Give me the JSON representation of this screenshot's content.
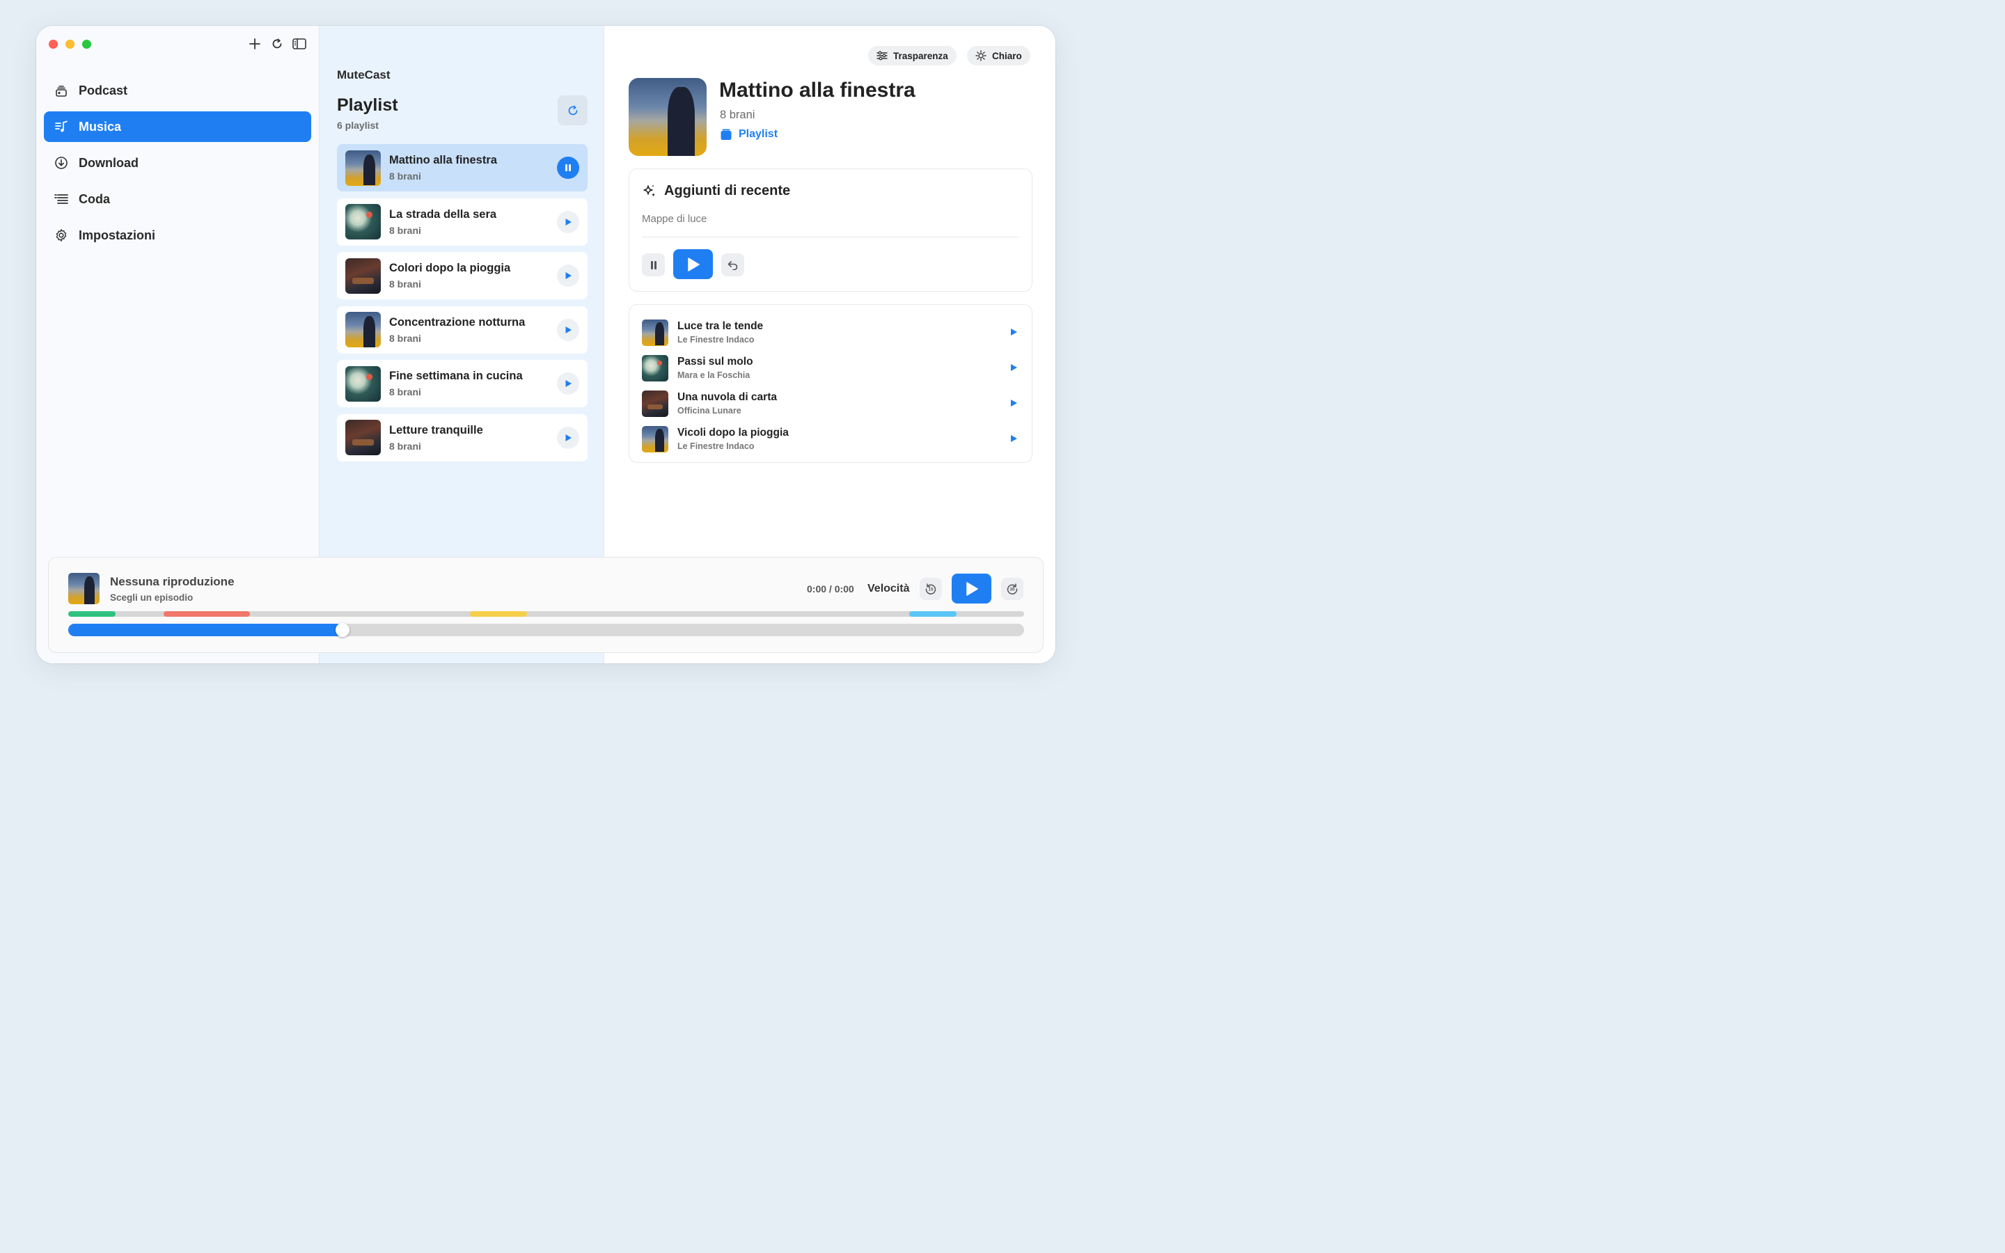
{
  "sidebar": {
    "tools": {
      "add": "plus-icon",
      "reload": "refresh-icon",
      "toggle": "sidebar-icon"
    },
    "items": [
      {
        "label": "Podcast",
        "icon": "podcast-stack-icon",
        "active": false
      },
      {
        "label": "Musica",
        "icon": "music-list-icon",
        "active": true
      },
      {
        "label": "Download",
        "icon": "download-circle-icon",
        "active": false
      },
      {
        "label": "Coda",
        "icon": "queue-list-icon",
        "active": false
      },
      {
        "label": "Impostazioni",
        "icon": "gear-icon",
        "active": false
      }
    ]
  },
  "middle": {
    "app_name": "MuteCast",
    "title": "Playlist",
    "count": "6 playlist",
    "playlists": [
      {
        "name": "Mattino alla finestra",
        "sub": "8 brani",
        "art": "a",
        "playing": true
      },
      {
        "name": "La strada della sera",
        "sub": "8 brani",
        "art": "b",
        "playing": false
      },
      {
        "name": "Colori dopo la pioggia",
        "sub": "8 brani",
        "art": "c",
        "playing": false
      },
      {
        "name": "Concentrazione notturna",
        "sub": "8 brani",
        "art": "a",
        "playing": false
      },
      {
        "name": "Fine settimana in cucina",
        "sub": "8 brani",
        "art": "b",
        "playing": false
      },
      {
        "name": "Letture tranquille",
        "sub": "8 brani",
        "art": "c",
        "playing": false
      }
    ]
  },
  "detail": {
    "pills": {
      "transparency": "Trasparenza",
      "light": "Chiaro"
    },
    "title": "Mattino alla finestra",
    "subtitle": "8 brani",
    "link": "Playlist",
    "recent": {
      "heading": "Aggiunti di recente",
      "sub": "Mappe di luce"
    },
    "tracks": [
      {
        "name": "Luce tra le tende",
        "artist": "Le Finestre Indaco",
        "art": "a"
      },
      {
        "name": "Passi sul molo",
        "artist": "Mara e la Foschia",
        "art": "b"
      },
      {
        "name": "Una nuvola di carta",
        "artist": "Officina Lunare",
        "art": "c"
      },
      {
        "name": "Vicoli dopo la pioggia",
        "artist": "Le Finestre Indaco",
        "art": "a"
      }
    ]
  },
  "player": {
    "title": "Nessuna riproduzione",
    "sub": "Scegli un episodio",
    "time": "0:00 / 0:00",
    "speed": "Velocità",
    "progress": 0.28,
    "chapter_colors": [
      "#2ec27e",
      "#f0776a",
      "#f6cf4a",
      "#5bc6f5"
    ]
  },
  "colors": {
    "accent": "#1f7ff2"
  }
}
